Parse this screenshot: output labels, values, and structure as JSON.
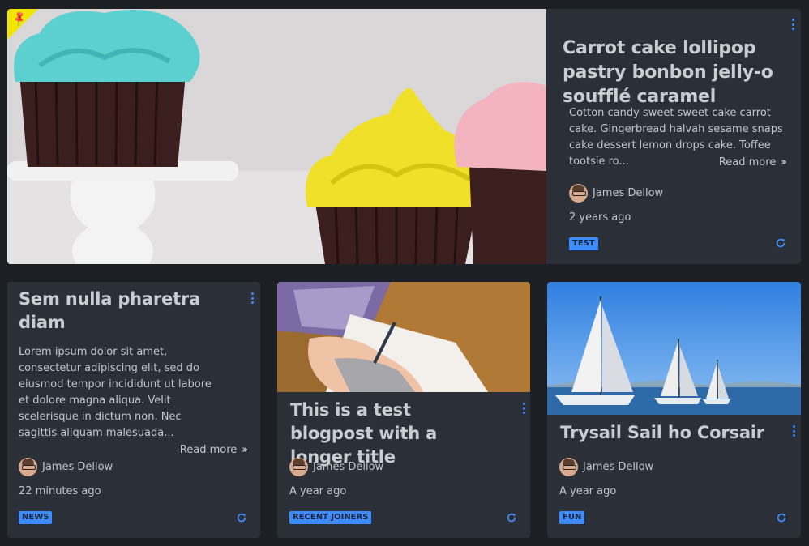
{
  "featured": {
    "title": "Carrot cake lollipop pastry bonbon jelly-o soufflé caramel",
    "excerpt": "Cotton candy sweet sweet cake carrot cake. Gingerbread halvah sesame snaps cake dessert lemon drops cake. Toffee tootsie ro...",
    "read_more": "Read more",
    "author": "James Dellow",
    "time": "2 years ago",
    "tag": "TEST",
    "image": "cupcakes"
  },
  "posts": [
    {
      "title": "Sem nulla pharetra diam",
      "excerpt": "Lorem ipsum dolor sit amet, consectetur adipiscing elit, sed do eiusmod tempor incididunt ut labore et dolore magna aliqua. Velit scelerisque in dictum non. Nec sagittis aliquam malesuada...",
      "read_more": "Read more",
      "author": "James Dellow",
      "time": "22 minutes ago",
      "tag": "NEWS"
    },
    {
      "title": "This is a test blogpost with a longer title",
      "author": "James Dellow",
      "time": "A year ago",
      "tag": "RECENT JOINERS",
      "image": "writing-hand"
    },
    {
      "title": "Trysail Sail ho Corsair",
      "author": "James Dellow",
      "time": "A year ago",
      "tag": "FUN",
      "image": "sailboats"
    }
  ],
  "colors": {
    "accent": "#3d8bfd",
    "pin": "#f2e600",
    "card": "#2b3038",
    "background": "#1c1f24"
  },
  "icons": [
    "pin-icon",
    "more-vertical-icon",
    "double-chevron-right-icon",
    "refresh-icon",
    "avatar"
  ]
}
